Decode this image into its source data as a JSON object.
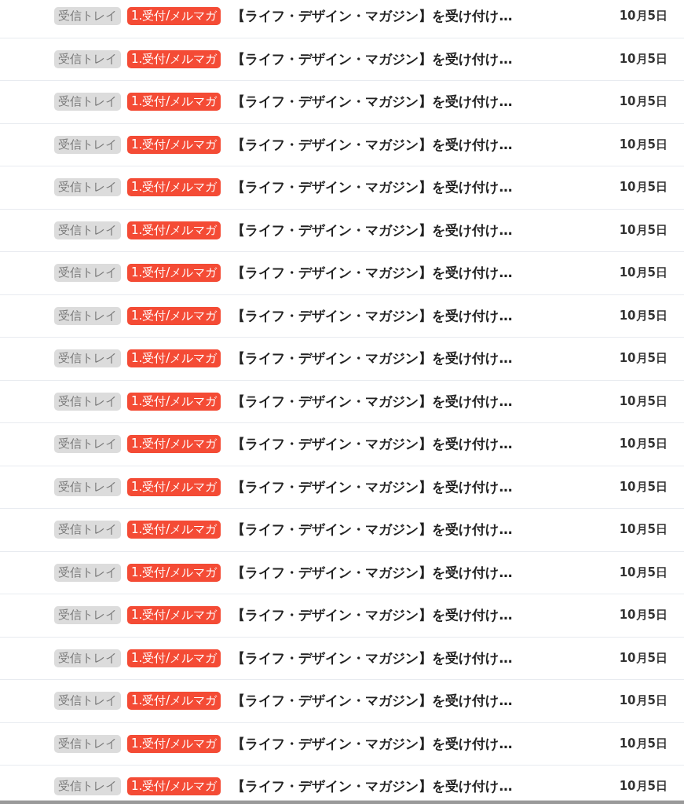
{
  "messages": [
    {
      "labels": [
        {
          "text": "受信トレイ",
          "kind": "folder"
        },
        {
          "text": "1.受付/メルマガ",
          "kind": "category"
        }
      ],
      "subject": "【ライフ・デザイン・マガジン】を受け付け…",
      "date": "10月5日"
    },
    {
      "labels": [
        {
          "text": "受信トレイ",
          "kind": "folder"
        },
        {
          "text": "1.受付/メルマガ",
          "kind": "category"
        }
      ],
      "subject": "【ライフ・デザイン・マガジン】を受け付け…",
      "date": "10月5日"
    },
    {
      "labels": [
        {
          "text": "受信トレイ",
          "kind": "folder"
        },
        {
          "text": "1.受付/メルマガ",
          "kind": "category"
        }
      ],
      "subject": "【ライフ・デザイン・マガジン】を受け付け…",
      "date": "10月5日"
    },
    {
      "labels": [
        {
          "text": "受信トレイ",
          "kind": "folder"
        },
        {
          "text": "1.受付/メルマガ",
          "kind": "category"
        }
      ],
      "subject": "【ライフ・デザイン・マガジン】を受け付け…",
      "date": "10月5日"
    },
    {
      "labels": [
        {
          "text": "受信トレイ",
          "kind": "folder"
        },
        {
          "text": "1.受付/メルマガ",
          "kind": "category"
        }
      ],
      "subject": "【ライフ・デザイン・マガジン】を受け付け…",
      "date": "10月5日"
    },
    {
      "labels": [
        {
          "text": "受信トレイ",
          "kind": "folder"
        },
        {
          "text": "1.受付/メルマガ",
          "kind": "category"
        }
      ],
      "subject": "【ライフ・デザイン・マガジン】を受け付け…",
      "date": "10月5日"
    },
    {
      "labels": [
        {
          "text": "受信トレイ",
          "kind": "folder"
        },
        {
          "text": "1.受付/メルマガ",
          "kind": "category"
        }
      ],
      "subject": "【ライフ・デザイン・マガジン】を受け付け…",
      "date": "10月5日"
    },
    {
      "labels": [
        {
          "text": "受信トレイ",
          "kind": "folder"
        },
        {
          "text": "1.受付/メルマガ",
          "kind": "category"
        }
      ],
      "subject": "【ライフ・デザイン・マガジン】を受け付け…",
      "date": "10月5日"
    },
    {
      "labels": [
        {
          "text": "受信トレイ",
          "kind": "folder"
        },
        {
          "text": "1.受付/メルマガ",
          "kind": "category"
        }
      ],
      "subject": "【ライフ・デザイン・マガジン】を受け付け…",
      "date": "10月5日"
    },
    {
      "labels": [
        {
          "text": "受信トレイ",
          "kind": "folder"
        },
        {
          "text": "1.受付/メルマガ",
          "kind": "category"
        }
      ],
      "subject": "【ライフ・デザイン・マガジン】を受け付け…",
      "date": "10月5日"
    },
    {
      "labels": [
        {
          "text": "受信トレイ",
          "kind": "folder"
        },
        {
          "text": "1.受付/メルマガ",
          "kind": "category"
        }
      ],
      "subject": "【ライフ・デザイン・マガジン】を受け付け…",
      "date": "10月5日"
    },
    {
      "labels": [
        {
          "text": "受信トレイ",
          "kind": "folder"
        },
        {
          "text": "1.受付/メルマガ",
          "kind": "category"
        }
      ],
      "subject": "【ライフ・デザイン・マガジン】を受け付け…",
      "date": "10月5日"
    },
    {
      "labels": [
        {
          "text": "受信トレイ",
          "kind": "folder"
        },
        {
          "text": "1.受付/メルマガ",
          "kind": "category"
        }
      ],
      "subject": "【ライフ・デザイン・マガジン】を受け付け…",
      "date": "10月5日"
    },
    {
      "labels": [
        {
          "text": "受信トレイ",
          "kind": "folder"
        },
        {
          "text": "1.受付/メルマガ",
          "kind": "category"
        }
      ],
      "subject": "【ライフ・デザイン・マガジン】を受け付け…",
      "date": "10月5日"
    },
    {
      "labels": [
        {
          "text": "受信トレイ",
          "kind": "folder"
        },
        {
          "text": "1.受付/メルマガ",
          "kind": "category"
        }
      ],
      "subject": "【ライフ・デザイン・マガジン】を受け付け…",
      "date": "10月5日"
    },
    {
      "labels": [
        {
          "text": "受信トレイ",
          "kind": "folder"
        },
        {
          "text": "1.受付/メルマガ",
          "kind": "category"
        }
      ],
      "subject": "【ライフ・デザイン・マガジン】を受け付け…",
      "date": "10月5日"
    },
    {
      "labels": [
        {
          "text": "受信トレイ",
          "kind": "folder"
        },
        {
          "text": "1.受付/メルマガ",
          "kind": "category"
        }
      ],
      "subject": "【ライフ・デザイン・マガジン】を受け付け…",
      "date": "10月5日"
    },
    {
      "labels": [
        {
          "text": "受信トレイ",
          "kind": "folder"
        },
        {
          "text": "1.受付/メルマガ",
          "kind": "category"
        }
      ],
      "subject": "【ライフ・デザイン・マガジン】を受け付け…",
      "date": "10月5日"
    },
    {
      "labels": [
        {
          "text": "受信トレイ",
          "kind": "folder"
        },
        {
          "text": "1.受付/メルマガ",
          "kind": "category"
        }
      ],
      "subject": "【ライフ・デザイン・マガジン】を受け付け…",
      "date": "10月5日"
    }
  ]
}
